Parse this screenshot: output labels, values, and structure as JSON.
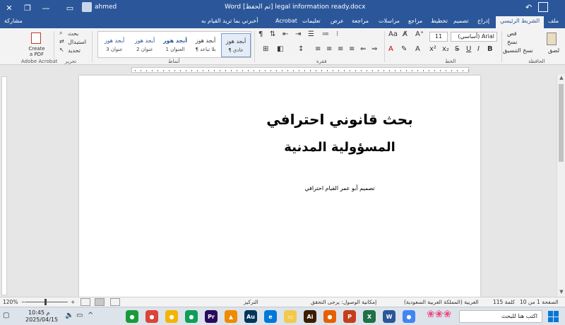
{
  "titlebar": {
    "title": "Word   [تم الحفظ] legal information ready.docx",
    "user": "ahmed",
    "min": "—",
    "restore": "❐",
    "close": "✕"
  },
  "tabs": {
    "items": [
      "ملف",
      "الشريط الرئيسي",
      "إدراج",
      "تصميم",
      "تخطيط",
      "مراجع",
      "مراسلات",
      "مراجعة",
      "عرض",
      "تعليمات",
      "Acrobat"
    ],
    "tell_me": "أخبرني بما تريد القيام به",
    "share": "مشاركة"
  },
  "ribbon": {
    "clipboard": {
      "paste": "لصق",
      "cut": "قص",
      "copy": "نسخ",
      "format_painter": "نسخ التنسيق",
      "label": "الحافظة"
    },
    "font": {
      "name": "Arial (أساسي)",
      "size": "11",
      "label": "الخط"
    },
    "paragraph": {
      "label": "فقرة"
    },
    "styles": {
      "label": "أنماط",
      "items": [
        {
          "sample": "أبجد هوز",
          "name": "¶ عادي"
        },
        {
          "sample": "أبجد هوز",
          "name": "¶ بلا تباعد"
        },
        {
          "sample": "أبجد هوز",
          "name": "العنوان 1"
        },
        {
          "sample": "أبجد هوز",
          "name": "عنوان 2"
        },
        {
          "sample": "أبجد هوز",
          "name": "عنوان 3"
        }
      ]
    },
    "editing": {
      "find": "بحث",
      "replace": "استبدال",
      "select": "تحديد",
      "label": "تحرير"
    },
    "acrobat": {
      "create_pdf": "Create a PDF",
      "label": "Adobe Acrobat"
    }
  },
  "document": {
    "title_line1": "بحث قانوني احترافي",
    "title_line2": "المسؤولية المدنية",
    "author": "تصميم أبو عمر القيام احترافي"
  },
  "statusbar": {
    "page": "الصفحة 1 من 10",
    "words": "115 كلمة",
    "language": "العربية (المملكة العربية السعودية)",
    "accessibility": "إمكانية الوصول: يرجى التحقق",
    "focus": "التركيز",
    "zoom": "120%"
  },
  "taskbar": {
    "search_placeholder": "اكتب هنا للبحث",
    "time": "10:45 م",
    "date": "2025/04/15",
    "apps": [
      {
        "name": "chrome",
        "color": "#1a9a3a",
        "glyph": "●"
      },
      {
        "name": "chrome2",
        "color": "#db4437",
        "glyph": "●"
      },
      {
        "name": "chrome3",
        "color": "#f4b400",
        "glyph": "●"
      },
      {
        "name": "chrome4",
        "color": "#0f9d58",
        "glyph": "●"
      },
      {
        "name": "premiere",
        "color": "#2a0a5c",
        "glyph": "Pr"
      },
      {
        "name": "vlc",
        "color": "#f08a00",
        "glyph": "▲"
      },
      {
        "name": "audition",
        "color": "#00365a",
        "glyph": "Au"
      },
      {
        "name": "edge",
        "color": "#0078d7",
        "glyph": "e"
      },
      {
        "name": "explorer",
        "color": "#f2c94c",
        "glyph": "▭"
      },
      {
        "name": "illustrator",
        "color": "#3b1d00",
        "glyph": "Ai"
      },
      {
        "name": "firefox",
        "color": "#e66000",
        "glyph": "●"
      },
      {
        "name": "powerpoint",
        "color": "#c43e1c",
        "glyph": "P"
      },
      {
        "name": "excel",
        "color": "#1e7145",
        "glyph": "X"
      },
      {
        "name": "word",
        "color": "#2b579a",
        "glyph": "W"
      },
      {
        "name": "chrome5",
        "color": "#4285f4",
        "glyph": "●"
      }
    ]
  }
}
